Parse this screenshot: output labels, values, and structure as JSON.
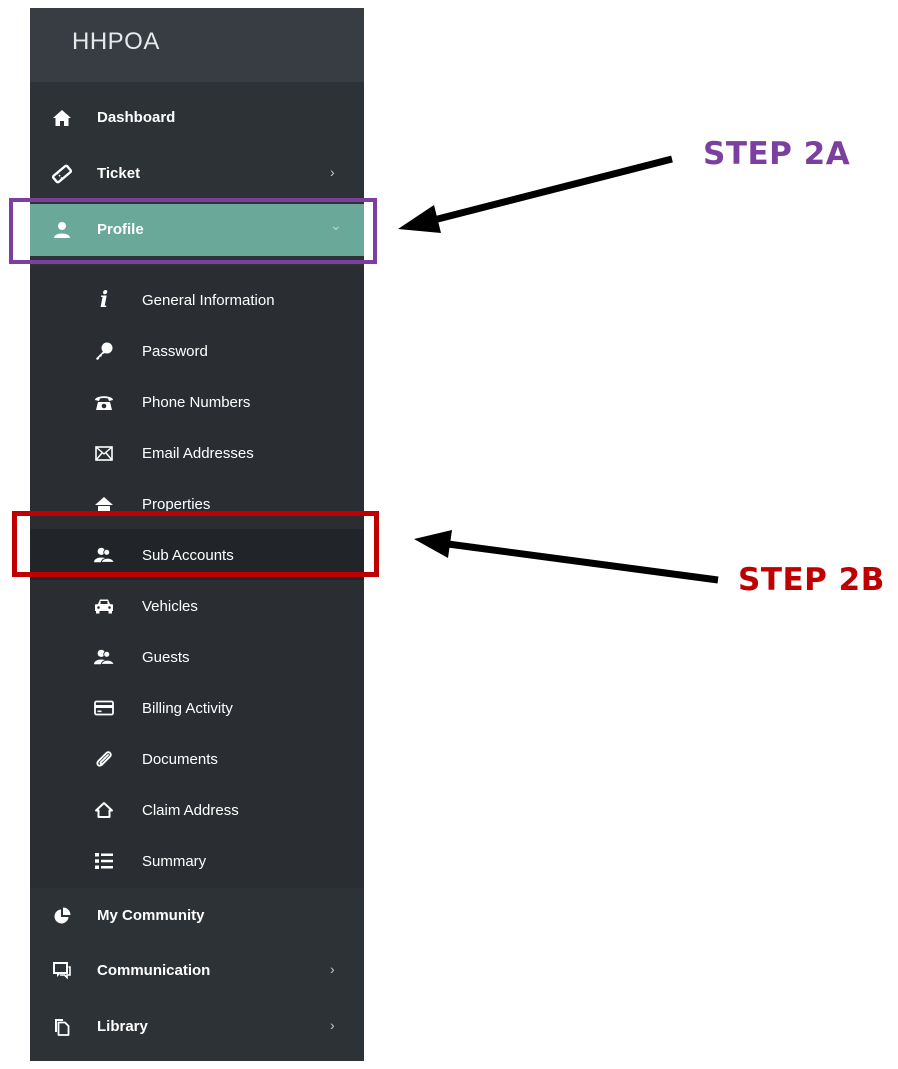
{
  "brand": "HHPOA",
  "nav_top": [
    {
      "label": "Dashboard",
      "icon": "home-icon"
    },
    {
      "label": "Ticket",
      "icon": "ticket-icon",
      "chevron": "›"
    },
    {
      "label": "Profile",
      "icon": "user-icon",
      "chevron": "⌄"
    }
  ],
  "profile_sub": [
    {
      "label": "General Information",
      "icon": "info-icon"
    },
    {
      "label": "Password",
      "icon": "key-icon"
    },
    {
      "label": "Phone Numbers",
      "icon": "phone-icon"
    },
    {
      "label": "Email Addresses",
      "icon": "envelope-icon"
    },
    {
      "label": "Properties",
      "icon": "home-icon"
    },
    {
      "label": "Sub Accounts",
      "icon": "users-icon"
    },
    {
      "label": "Vehicles",
      "icon": "car-icon"
    },
    {
      "label": "Guests",
      "icon": "users-icon"
    },
    {
      "label": "Billing Activity",
      "icon": "credit-card-icon"
    },
    {
      "label": "Documents",
      "icon": "paperclip-icon"
    },
    {
      "label": "Claim Address",
      "icon": "home-outline-icon"
    },
    {
      "label": "Summary",
      "icon": "list-icon"
    }
  ],
  "nav_bottom": [
    {
      "label": "My Community",
      "icon": "pie-chart-icon"
    },
    {
      "label": "Communication",
      "icon": "chat-icon",
      "chevron": "›"
    },
    {
      "label": "Library",
      "icon": "copy-icon",
      "chevron": "›"
    }
  ],
  "annotations": {
    "step_2a": {
      "label": "STEP 2A",
      "color": "#7b3fa0"
    },
    "step_2b": {
      "label": "STEP 2B",
      "color": "#c00000"
    }
  },
  "colors": {
    "sidebar_bg": "#2d3236",
    "brand_bg": "#373d42",
    "active_item": "#6aa99a",
    "submenu_bg": "#2a2e32",
    "selected_sub": "#212529"
  }
}
